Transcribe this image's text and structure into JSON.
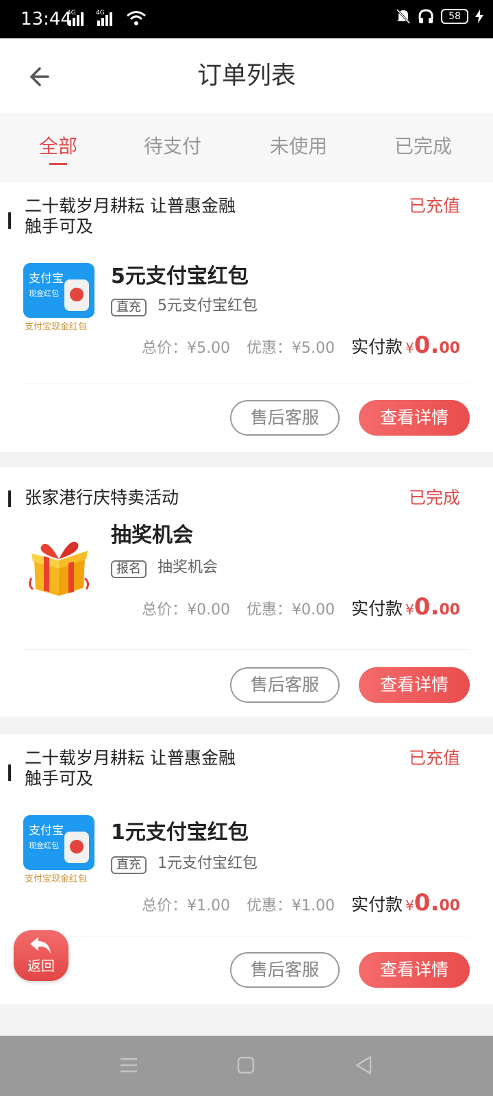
{
  "status_bar": {
    "time": "13:44",
    "signal_labels": [
      "4G",
      "4G"
    ],
    "battery": "58"
  },
  "header": {
    "title": "订单列表"
  },
  "tabs": [
    {
      "label": "全部",
      "active": true
    },
    {
      "label": "待支付",
      "active": false
    },
    {
      "label": "未使用",
      "active": false
    },
    {
      "label": "已完成",
      "active": false
    }
  ],
  "orders": [
    {
      "shop": "二十载岁月耕耘 让普惠金融触手可及",
      "status": "已充值",
      "thumb_icon": "alipay-red-packet-icon",
      "thumb_caption": "支付宝现金红包",
      "thumb_top": "支付宝",
      "thumb_sub": "现金红包",
      "product": "5元支付宝红包",
      "tag": "直充",
      "subtitle": "5元支付宝红包",
      "total": "总价：¥5.00",
      "discount": "优惠：¥5.00",
      "pay_label": "实付款",
      "pay_currency": "¥",
      "pay_int": "0.",
      "pay_dec": "00",
      "service_label": "售后客服",
      "detail_label": "查看详情"
    },
    {
      "shop": "张家港行庆特卖活动",
      "status": "已完成",
      "thumb_icon": "gift-box-icon",
      "product": "抽奖机会",
      "tag": "报名",
      "subtitle": "抽奖机会",
      "total": "总价：¥0.00",
      "discount": "优惠：¥0.00",
      "pay_label": "实付款",
      "pay_currency": "¥",
      "pay_int": "0.",
      "pay_dec": "00",
      "service_label": "售后客服",
      "detail_label": "查看详情"
    },
    {
      "shop": "二十载岁月耕耘 让普惠金融触手可及",
      "status": "已充值",
      "thumb_icon": "alipay-red-packet-icon",
      "thumb_caption": "支付宝现金红包",
      "thumb_top": "支付宝",
      "thumb_sub": "现金红包",
      "product": "1元支付宝红包",
      "tag": "直充",
      "subtitle": "1元支付宝红包",
      "total": "总价：¥1.00",
      "discount": "优惠：¥1.00",
      "pay_label": "实付款",
      "pay_currency": "¥",
      "pay_int": "0.",
      "pay_dec": "00",
      "service_label": "售后客服",
      "detail_label": "查看详情"
    }
  ],
  "float_back": {
    "label": "返回"
  },
  "colors": {
    "accent": "#e24a4a",
    "button_gradient_start": "#f46b6b",
    "navbar": "#9a9a9a"
  }
}
